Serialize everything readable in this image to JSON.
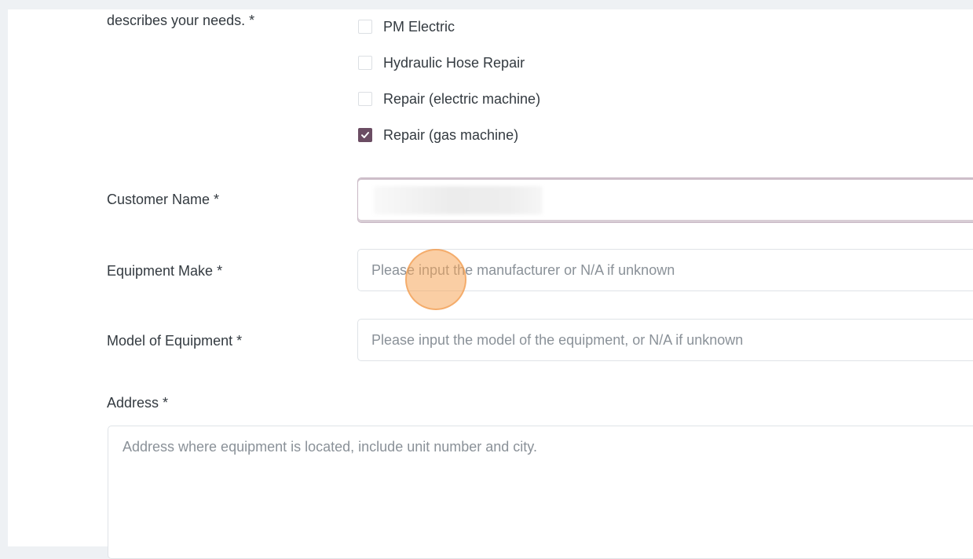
{
  "form": {
    "needs_label_partial": "describes your needs. *",
    "service_options": [
      {
        "label": "PM Electric",
        "checked": false
      },
      {
        "label": "Hydraulic Hose Repair",
        "checked": false
      },
      {
        "label": "Repair (electric machine)",
        "checked": false
      },
      {
        "label": "Repair (gas machine)",
        "checked": true
      }
    ],
    "customer_name": {
      "label": "Customer Name *",
      "value": ""
    },
    "equipment_make": {
      "label": "Equipment Make *",
      "placeholder": "Please input the manufacturer or N/A if unknown"
    },
    "equipment_model": {
      "label": "Model of Equipment *",
      "placeholder": "Please input the model of the equipment, or N/A if unknown"
    },
    "address": {
      "label": "Address *",
      "placeholder": "Address where equipment is located, include unit number and city."
    }
  },
  "colors": {
    "accent": "#6b4d63",
    "click_indicator": "#f5a65a"
  },
  "icons": {
    "checkmark": "check-icon"
  }
}
